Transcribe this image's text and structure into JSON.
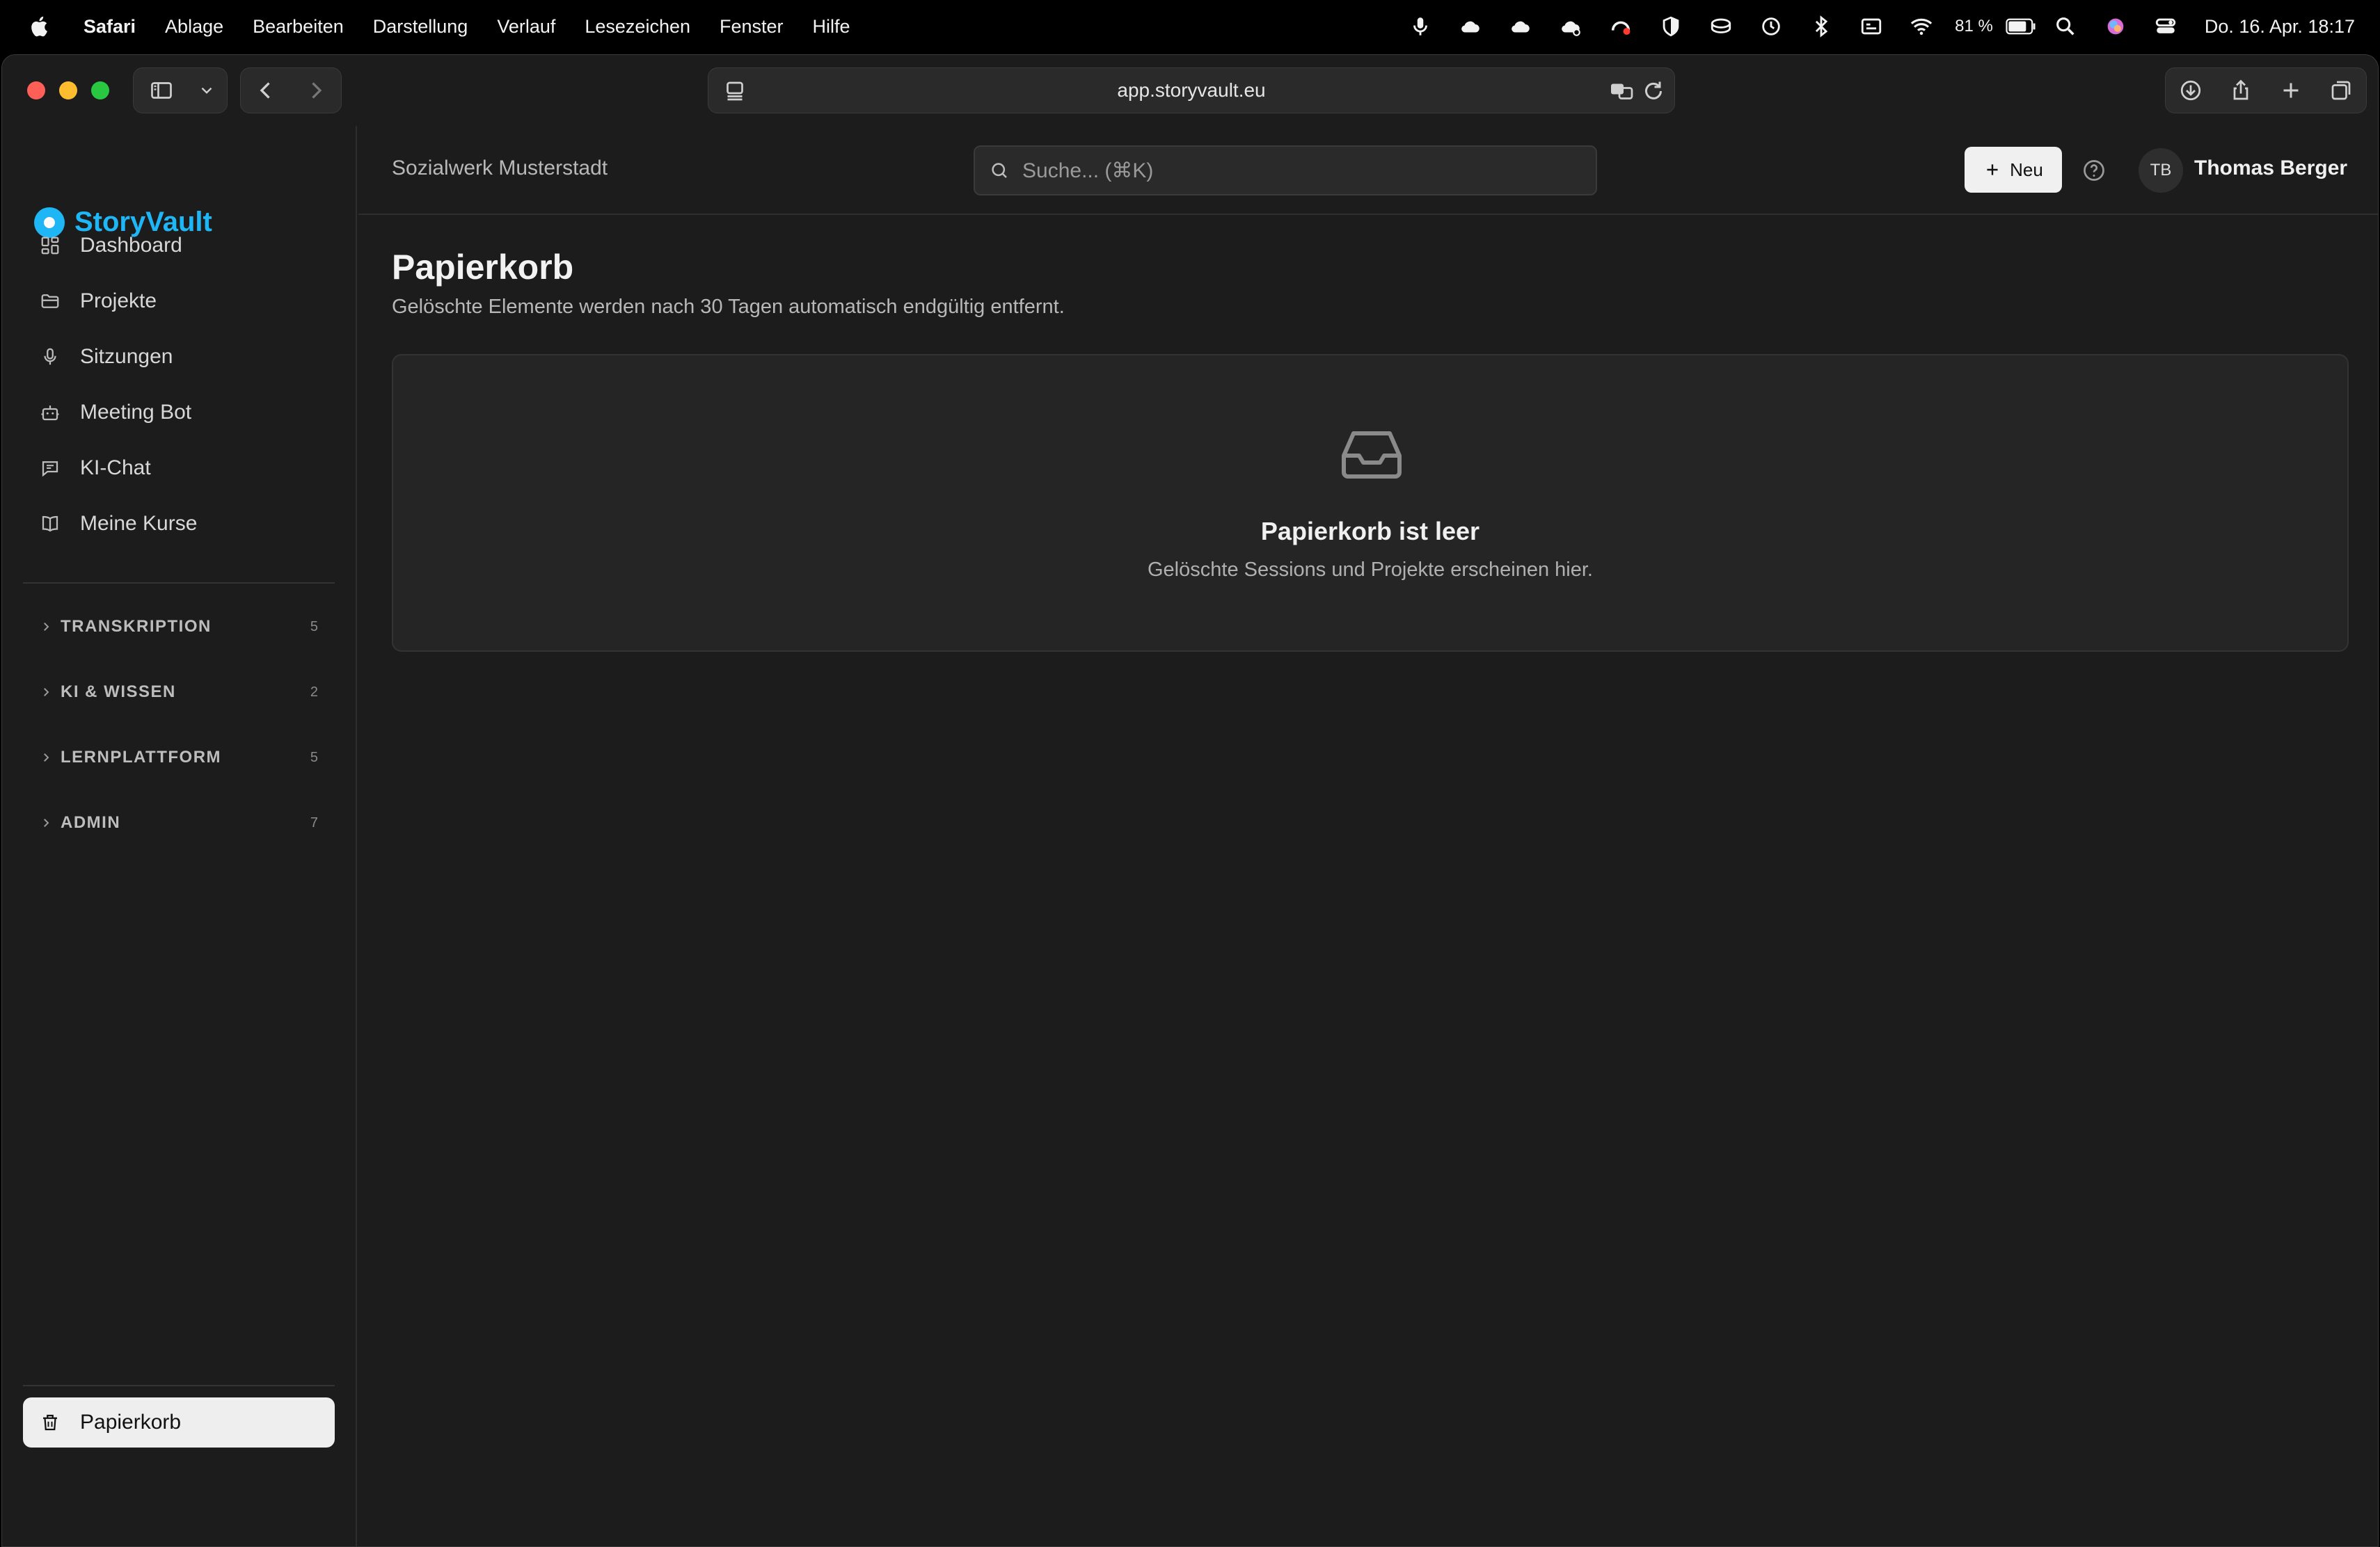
{
  "menubar": {
    "app": "Safari",
    "items": [
      "Ablage",
      "Bearbeiten",
      "Darstellung",
      "Verlauf",
      "Lesezeichen",
      "Fenster",
      "Hilfe"
    ],
    "battery": "81 %",
    "clock": "Do. 16. Apr.  18:17"
  },
  "browser": {
    "url": "app.storyvault.eu"
  },
  "brand": {
    "name": "StoryVault",
    "color": "#1fb6f5"
  },
  "sidebar": {
    "nav": [
      {
        "label": "Dashboard",
        "icon": "dashboard-icon"
      },
      {
        "label": "Projekte",
        "icon": "folder-icon"
      },
      {
        "label": "Sitzungen",
        "icon": "microphone-icon"
      },
      {
        "label": "Meeting Bot",
        "icon": "bot-icon"
      },
      {
        "label": "KI-Chat",
        "icon": "chat-icon"
      },
      {
        "label": "Meine Kurse",
        "icon": "book-icon"
      }
    ],
    "groups": [
      {
        "label": "TRANSKRIPTION",
        "count": "5"
      },
      {
        "label": "KI & WISSEN",
        "count": "2"
      },
      {
        "label": "LERNPLATTFORM",
        "count": "5"
      },
      {
        "label": "ADMIN",
        "count": "7"
      }
    ],
    "trash": "Papierkorb"
  },
  "header": {
    "organization": "Sozialwerk Musterstadt",
    "search_placeholder": "Suche... (⌘K)",
    "new_button": "Neu",
    "avatar_initials": "TB",
    "user_name": "Thomas Berger"
  },
  "main": {
    "title": "Papierkorb",
    "subtitle": "Gelöschte Elemente werden nach 30 Tagen automatisch endgültig entfernt.",
    "empty_title": "Papierkorb ist leer",
    "empty_text": "Gelöschte Sessions und Projekte erscheinen hier."
  }
}
